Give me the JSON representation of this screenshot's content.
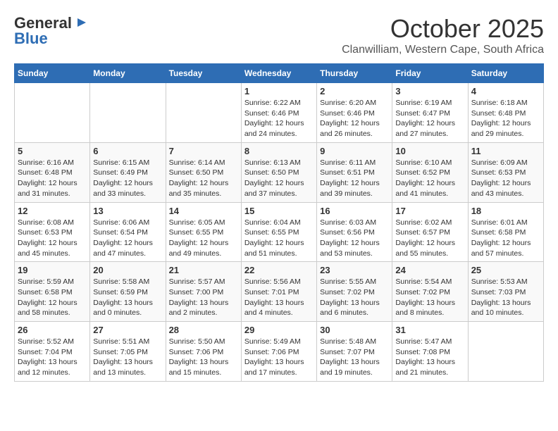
{
  "logo": {
    "line1": "General",
    "line2": "Blue"
  },
  "header": {
    "month_title": "October 2025",
    "subtitle": "Clanwilliam, Western Cape, South Africa"
  },
  "weekdays": [
    "Sunday",
    "Monday",
    "Tuesday",
    "Wednesday",
    "Thursday",
    "Friday",
    "Saturday"
  ],
  "weeks": [
    [
      {
        "day": "",
        "info": ""
      },
      {
        "day": "",
        "info": ""
      },
      {
        "day": "",
        "info": ""
      },
      {
        "day": "1",
        "info": "Sunrise: 6:22 AM\nSunset: 6:46 PM\nDaylight: 12 hours\nand 24 minutes."
      },
      {
        "day": "2",
        "info": "Sunrise: 6:20 AM\nSunset: 6:46 PM\nDaylight: 12 hours\nand 26 minutes."
      },
      {
        "day": "3",
        "info": "Sunrise: 6:19 AM\nSunset: 6:47 PM\nDaylight: 12 hours\nand 27 minutes."
      },
      {
        "day": "4",
        "info": "Sunrise: 6:18 AM\nSunset: 6:48 PM\nDaylight: 12 hours\nand 29 minutes."
      }
    ],
    [
      {
        "day": "5",
        "info": "Sunrise: 6:16 AM\nSunset: 6:48 PM\nDaylight: 12 hours\nand 31 minutes."
      },
      {
        "day": "6",
        "info": "Sunrise: 6:15 AM\nSunset: 6:49 PM\nDaylight: 12 hours\nand 33 minutes."
      },
      {
        "day": "7",
        "info": "Sunrise: 6:14 AM\nSunset: 6:50 PM\nDaylight: 12 hours\nand 35 minutes."
      },
      {
        "day": "8",
        "info": "Sunrise: 6:13 AM\nSunset: 6:50 PM\nDaylight: 12 hours\nand 37 minutes."
      },
      {
        "day": "9",
        "info": "Sunrise: 6:11 AM\nSunset: 6:51 PM\nDaylight: 12 hours\nand 39 minutes."
      },
      {
        "day": "10",
        "info": "Sunrise: 6:10 AM\nSunset: 6:52 PM\nDaylight: 12 hours\nand 41 minutes."
      },
      {
        "day": "11",
        "info": "Sunrise: 6:09 AM\nSunset: 6:53 PM\nDaylight: 12 hours\nand 43 minutes."
      }
    ],
    [
      {
        "day": "12",
        "info": "Sunrise: 6:08 AM\nSunset: 6:53 PM\nDaylight: 12 hours\nand 45 minutes."
      },
      {
        "day": "13",
        "info": "Sunrise: 6:06 AM\nSunset: 6:54 PM\nDaylight: 12 hours\nand 47 minutes."
      },
      {
        "day": "14",
        "info": "Sunrise: 6:05 AM\nSunset: 6:55 PM\nDaylight: 12 hours\nand 49 minutes."
      },
      {
        "day": "15",
        "info": "Sunrise: 6:04 AM\nSunset: 6:55 PM\nDaylight: 12 hours\nand 51 minutes."
      },
      {
        "day": "16",
        "info": "Sunrise: 6:03 AM\nSunset: 6:56 PM\nDaylight: 12 hours\nand 53 minutes."
      },
      {
        "day": "17",
        "info": "Sunrise: 6:02 AM\nSunset: 6:57 PM\nDaylight: 12 hours\nand 55 minutes."
      },
      {
        "day": "18",
        "info": "Sunrise: 6:01 AM\nSunset: 6:58 PM\nDaylight: 12 hours\nand 57 minutes."
      }
    ],
    [
      {
        "day": "19",
        "info": "Sunrise: 5:59 AM\nSunset: 6:58 PM\nDaylight: 12 hours\nand 58 minutes."
      },
      {
        "day": "20",
        "info": "Sunrise: 5:58 AM\nSunset: 6:59 PM\nDaylight: 13 hours\nand 0 minutes."
      },
      {
        "day": "21",
        "info": "Sunrise: 5:57 AM\nSunset: 7:00 PM\nDaylight: 13 hours\nand 2 minutes."
      },
      {
        "day": "22",
        "info": "Sunrise: 5:56 AM\nSunset: 7:01 PM\nDaylight: 13 hours\nand 4 minutes."
      },
      {
        "day": "23",
        "info": "Sunrise: 5:55 AM\nSunset: 7:02 PM\nDaylight: 13 hours\nand 6 minutes."
      },
      {
        "day": "24",
        "info": "Sunrise: 5:54 AM\nSunset: 7:02 PM\nDaylight: 13 hours\nand 8 minutes."
      },
      {
        "day": "25",
        "info": "Sunrise: 5:53 AM\nSunset: 7:03 PM\nDaylight: 13 hours\nand 10 minutes."
      }
    ],
    [
      {
        "day": "26",
        "info": "Sunrise: 5:52 AM\nSunset: 7:04 PM\nDaylight: 13 hours\nand 12 minutes."
      },
      {
        "day": "27",
        "info": "Sunrise: 5:51 AM\nSunset: 7:05 PM\nDaylight: 13 hours\nand 13 minutes."
      },
      {
        "day": "28",
        "info": "Sunrise: 5:50 AM\nSunset: 7:06 PM\nDaylight: 13 hours\nand 15 minutes."
      },
      {
        "day": "29",
        "info": "Sunrise: 5:49 AM\nSunset: 7:06 PM\nDaylight: 13 hours\nand 17 minutes."
      },
      {
        "day": "30",
        "info": "Sunrise: 5:48 AM\nSunset: 7:07 PM\nDaylight: 13 hours\nand 19 minutes."
      },
      {
        "day": "31",
        "info": "Sunrise: 5:47 AM\nSunset: 7:08 PM\nDaylight: 13 hours\nand 21 minutes."
      },
      {
        "day": "",
        "info": ""
      }
    ]
  ]
}
